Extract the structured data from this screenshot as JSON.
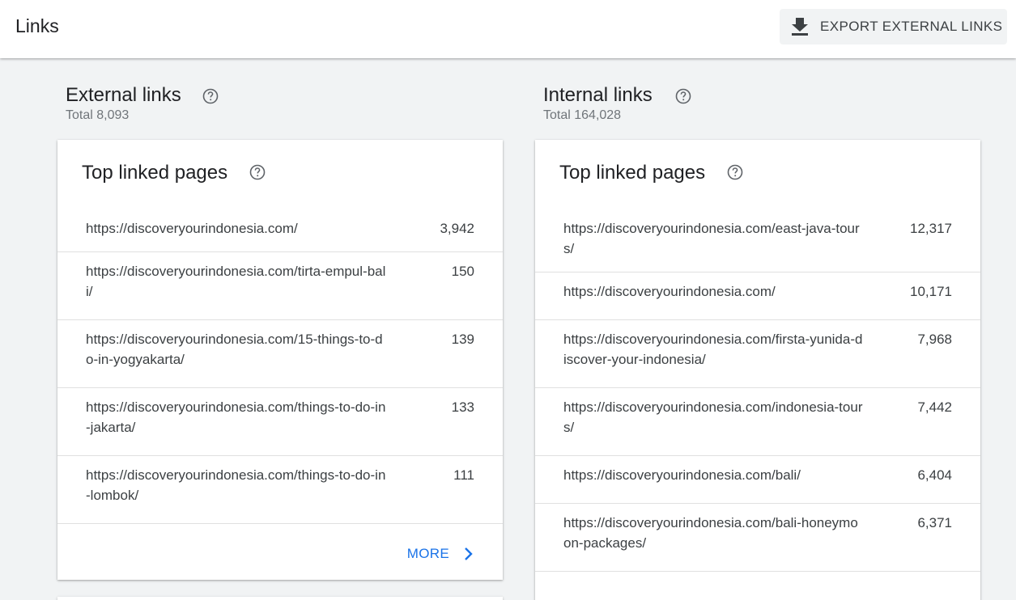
{
  "header": {
    "title": "Links",
    "export_label": "EXPORT EXTERNAL LINKS"
  },
  "external": {
    "title": "External links",
    "total": "Total 8,093",
    "card_title": "Top linked pages",
    "rows": [
      {
        "url": "https://discoveryourindonesia.com/",
        "count": "3,942"
      },
      {
        "url": "https://discoveryourindonesia.com/tirta-empul-bali/",
        "count": "150"
      },
      {
        "url": "https://discoveryourindonesia.com/15-things-to-do-in-yogyakarta/",
        "count": "139"
      },
      {
        "url": "https://discoveryourindonesia.com/things-to-do-in-jakarta/",
        "count": "133"
      },
      {
        "url": "https://discoveryourindonesia.com/things-to-do-in-lombok/",
        "count": "111"
      }
    ],
    "more_label": "MORE"
  },
  "internal": {
    "title": "Internal links",
    "total": "Total 164,028",
    "card_title": "Top linked pages",
    "rows": [
      {
        "url": "https://discoveryourindonesia.com/east-java-tours/",
        "count": "12,317"
      },
      {
        "url": "https://discoveryourindonesia.com/",
        "count": "10,171"
      },
      {
        "url": "https://discoveryourindonesia.com/firsta-yunida-discover-your-indonesia/",
        "count": "7,968"
      },
      {
        "url": "https://discoveryourindonesia.com/indonesia-tours/",
        "count": "7,442"
      },
      {
        "url": "https://discoveryourindonesia.com/bali/",
        "count": "6,404"
      },
      {
        "url": "https://discoveryourindonesia.com/bali-honeymoon-packages/",
        "count": "6,371"
      }
    ]
  },
  "colors": {
    "accent": "#1a73e8",
    "background": "#f1f3f4"
  },
  "icons": {
    "export": "download-icon",
    "help": "help-circle-icon",
    "more": "chevron-right-icon"
  }
}
